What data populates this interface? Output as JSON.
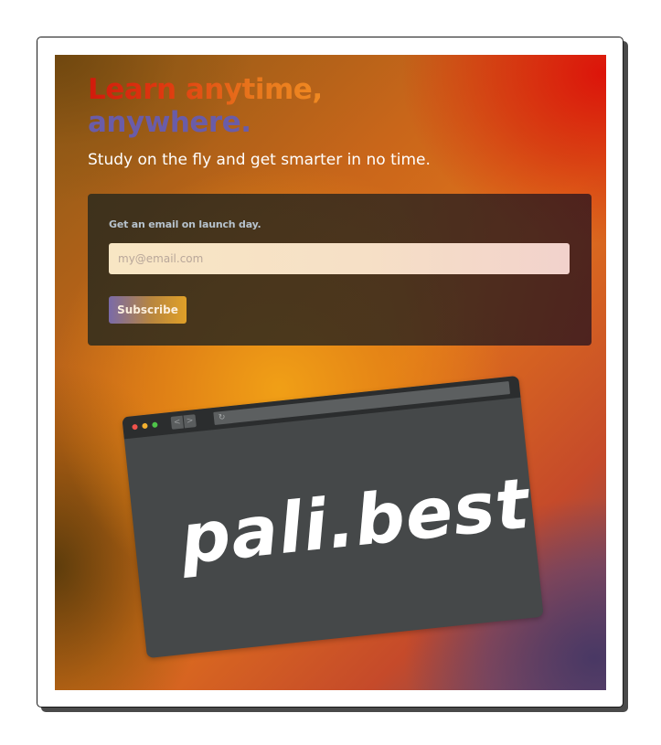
{
  "hero": {
    "headline_line1": "Learn anytime,",
    "headline_line2": "anywhere.",
    "subtitle": "Study on the fly and get smarter in no time."
  },
  "signup": {
    "label": "Get an email on launch day.",
    "email_placeholder": "my@email.com",
    "email_value": "",
    "subscribe_label": "Subscribe"
  },
  "browser_mockup": {
    "nav_back_glyph": "<",
    "nav_forward_glyph": ">",
    "reload_glyph": "↻",
    "brand_text": "pali.best"
  },
  "colors": {
    "headline_gradient_start": "#d11a0c",
    "headline_gradient_end": "#f08a22",
    "headline_line2": "#6a5ca8",
    "card_label": "#b6c2cc",
    "browser_body": "#454849",
    "browser_bar": "#2b2d2e",
    "traffic_red": "#f0524c",
    "traffic_yellow": "#f3b02f",
    "traffic_green": "#4ec449"
  },
  "icons": [
    "back-arrow-icon",
    "forward-arrow-icon",
    "reload-icon"
  ]
}
